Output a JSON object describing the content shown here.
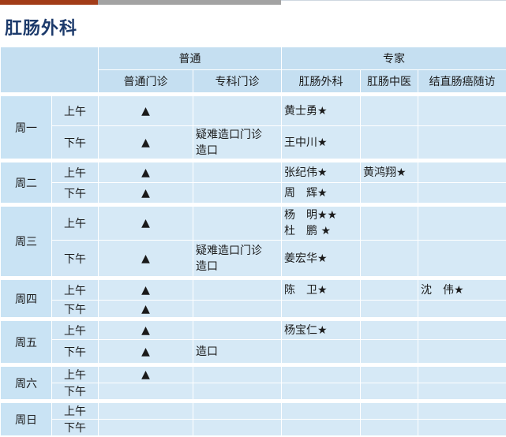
{
  "title": "肛肠外科",
  "groups": {
    "general": "普通",
    "expert": "专家"
  },
  "columns": [
    "普通门诊",
    "专科门诊",
    "肛肠外科",
    "肛肠中医",
    "结直肠癌随访"
  ],
  "tri": "▲",
  "rows": [
    {
      "day": "周一",
      "am": "上午",
      "pm": "下午",
      "am_special": "",
      "am_surgery": "黄士勇★",
      "am_tcm": "",
      "am_followup": "",
      "pm_special": "疑难造口门诊\n造口",
      "pm_surgery": "王中川★",
      "pm_tcm": "",
      "pm_followup": ""
    },
    {
      "day": "周二",
      "am": "上午",
      "pm": "下午",
      "am_special": "",
      "am_surgery": "张纪伟★",
      "am_tcm": "黄鸿翔★",
      "am_followup": "",
      "pm_special": "",
      "pm_surgery": "周　辉★",
      "pm_tcm": "",
      "pm_followup": ""
    },
    {
      "day": "周三",
      "am": "上午",
      "pm": "下午",
      "am_special": "",
      "am_surgery": "杨　明★★\n杜　鹏 ★",
      "am_tcm": "",
      "am_followup": "",
      "pm_special": "疑难造口门诊\n造口",
      "pm_surgery": "姜宏华★",
      "pm_tcm": "",
      "pm_followup": ""
    },
    {
      "day": "周四",
      "am": "上午",
      "pm": "下午",
      "am_special": "",
      "am_surgery": "陈　卫★",
      "am_tcm": "",
      "am_followup": "沈　伟★",
      "pm_special": "",
      "pm_surgery": "",
      "pm_tcm": "",
      "pm_followup": ""
    },
    {
      "day": "周五",
      "am": "上午",
      "pm": "下午",
      "am_special": "",
      "am_surgery": "杨宝仁★",
      "am_tcm": "",
      "am_followup": "",
      "pm_special": "造口",
      "pm_surgery": "",
      "pm_tcm": "",
      "pm_followup": ""
    },
    {
      "day": "周六",
      "am": "上午",
      "pm": "下午",
      "am_special": "",
      "am_surgery": "",
      "am_tcm": "",
      "am_followup": "",
      "pm_special": "",
      "pm_surgery": "",
      "pm_tcm": "",
      "pm_followup": ""
    },
    {
      "day": "周日",
      "am": "上午",
      "pm": "下午",
      "am_special": "",
      "am_surgery": "",
      "am_tcm": "",
      "am_followup": "",
      "pm_special": "",
      "pm_surgery": "",
      "pm_tcm": "",
      "pm_followup": ""
    }
  ]
}
